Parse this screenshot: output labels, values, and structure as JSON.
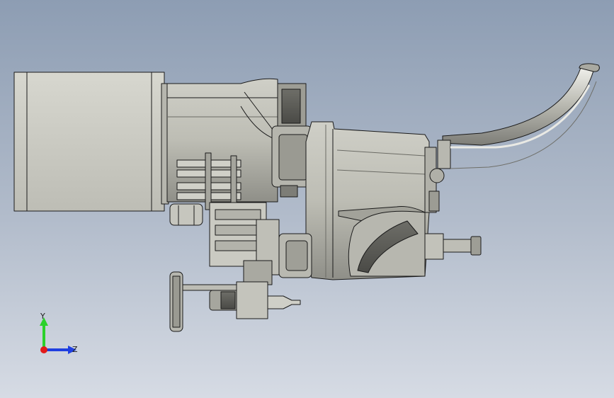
{
  "viewport": {
    "background_top": "#8d9db3",
    "background_bottom": "#d6dbe4"
  },
  "model": {
    "part_color": "#c9c9c1",
    "shade_color": "#9f9f97",
    "edge_color": "#1a1a1a"
  },
  "triad": {
    "y_label": "Y",
    "z_label": "Z",
    "y_color": "#2bd12b",
    "z_color": "#1f3fe0",
    "x_color": "#e21a1a"
  }
}
